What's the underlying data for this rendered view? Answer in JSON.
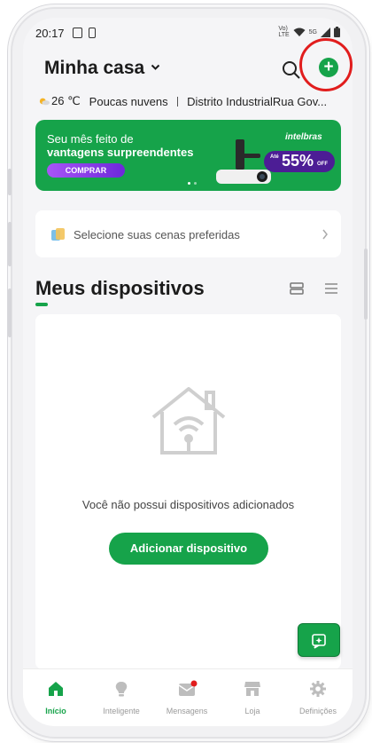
{
  "status_bar": {
    "time": "20:17",
    "network_top": "Vo)",
    "network_bottom": "LTE",
    "signal_type": "5G"
  },
  "header": {
    "title": "Minha casa",
    "icons": [
      "chevron-down-icon",
      "search-icon",
      "plus-icon"
    ]
  },
  "weather": {
    "temperature": "26 ℃",
    "condition": "Poucas nuvens",
    "location": "Distrito IndustrialRua Gov..."
  },
  "banner": {
    "line1": "Seu mês feito de",
    "line2": "vantagens surpreendentes",
    "button": "COMPRAR",
    "brand": "intelbras",
    "discount_prefix": "Até",
    "discount": "55%",
    "discount_suffix": "OFF",
    "slides": 2,
    "active_slide": 1
  },
  "scenes": {
    "label": "Selecione suas cenas preferidas"
  },
  "devices": {
    "title": "Meus dispositivos",
    "empty_message": "Você não possui dispositivos adicionados",
    "add_button": "Adicionar dispositivo"
  },
  "bottom_nav": {
    "items": [
      {
        "label": "Início",
        "icon": "home-icon",
        "active": true
      },
      {
        "label": "Inteligente",
        "icon": "lightbulb-icon",
        "active": false
      },
      {
        "label": "Mensagens",
        "icon": "message-icon",
        "active": false
      },
      {
        "label": "Loja",
        "icon": "store-icon",
        "active": false
      },
      {
        "label": "Definições",
        "icon": "gear-icon",
        "active": false
      }
    ]
  },
  "colors": {
    "accent": "#16a34a",
    "highlight": "#e11d1d",
    "promo_purple": "#4c1d95"
  }
}
